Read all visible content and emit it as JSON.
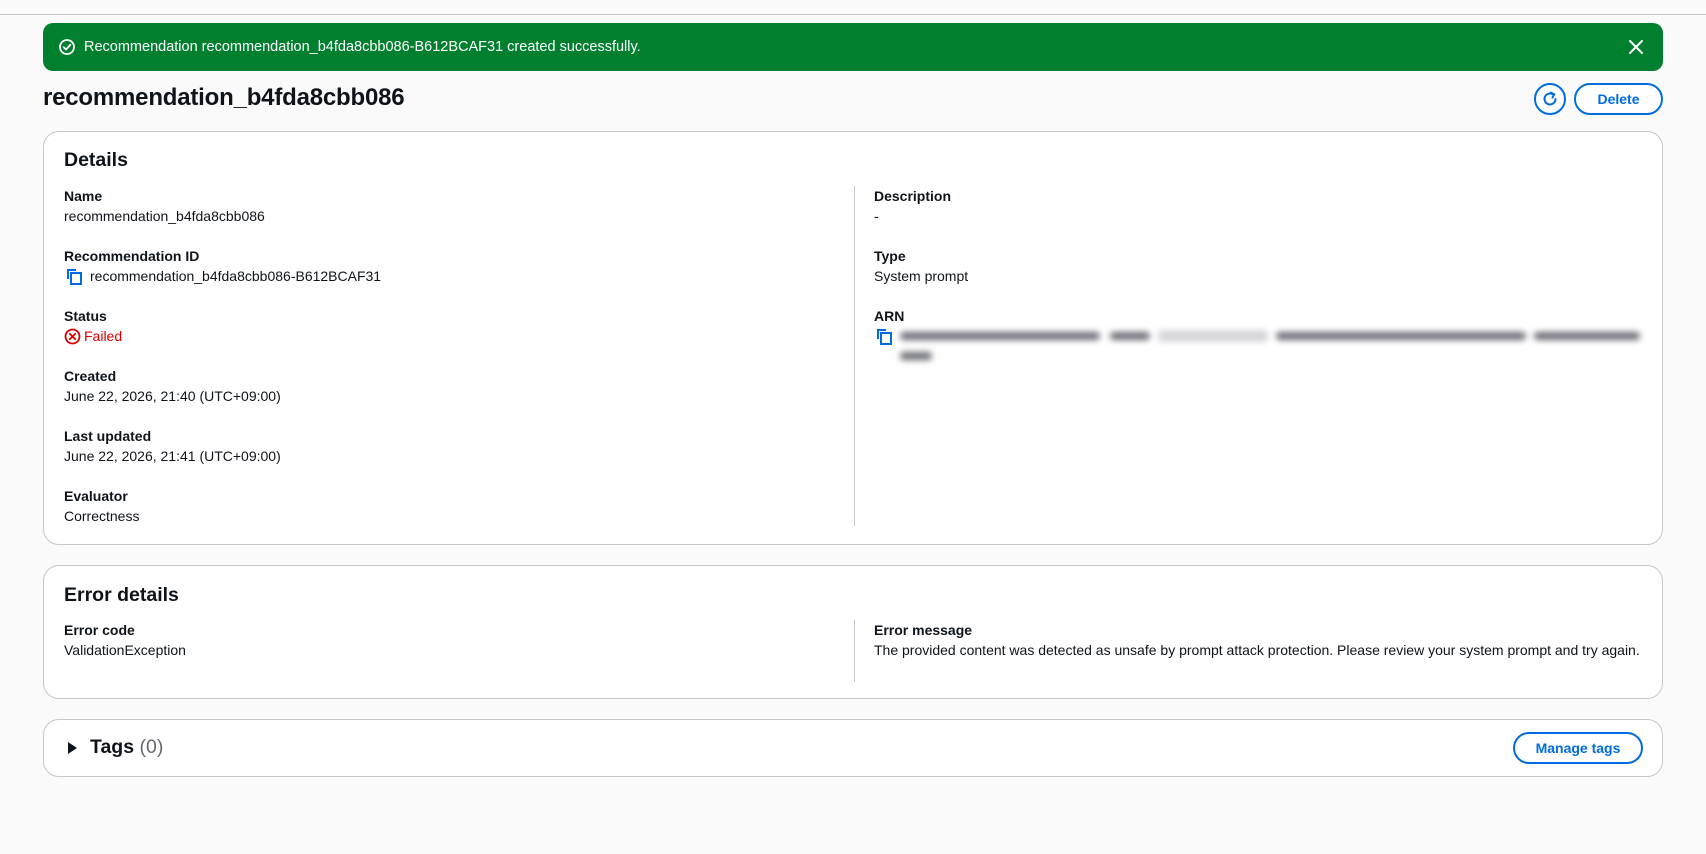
{
  "flash": {
    "message": "Recommendation recommendation_b4fda8cbb086-B612BCAF31 created successfully.",
    "icon": "check-circle-icon",
    "dismiss_icon": "close-icon",
    "color": "#00802f"
  },
  "header": {
    "title": "recommendation_b4fda8cbb086",
    "refresh_icon": "refresh-icon",
    "delete_label": "Delete"
  },
  "details": {
    "title": "Details",
    "name_label": "Name",
    "name_value": "recommendation_b4fda8cbb086",
    "rec_id_label": "Recommendation ID",
    "rec_id_value": "recommendation_b4fda8cbb086-B612BCAF31",
    "status_label": "Status",
    "status_value": "Failed",
    "status_color": "#db0000",
    "created_label": "Created",
    "created_value": "June 22, 2026, 21:40 (UTC+09:00)",
    "updated_label": "Last updated",
    "updated_value": "June 22, 2026, 21:41 (UTC+09:00)",
    "evaluator_label": "Evaluator",
    "evaluator_value": "Correctness",
    "description_label": "Description",
    "description_value": "-",
    "type_label": "Type",
    "type_value": "System prompt",
    "arn_label": "ARN"
  },
  "error_details": {
    "title": "Error details",
    "code_label": "Error code",
    "code_value": "ValidationException",
    "message_label": "Error message",
    "message_value": "The provided content was detected as unsafe by prompt attack protection. Please review your system prompt and try again."
  },
  "tags": {
    "title": "Tags",
    "count": "(0)",
    "manage_label": "Manage tags"
  },
  "accent_color": "#006ce0"
}
